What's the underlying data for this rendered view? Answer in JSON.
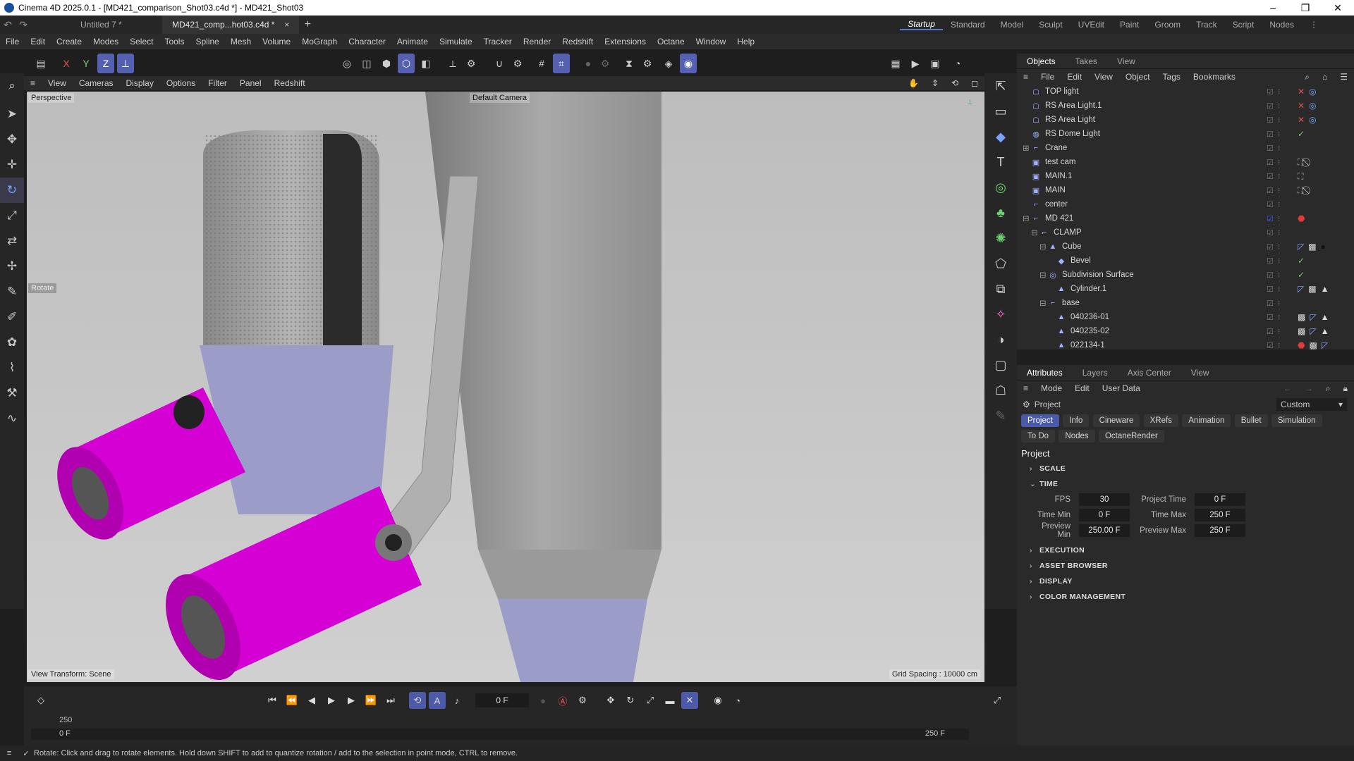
{
  "window": {
    "title": "Cinema 4D 2025.0.1 - [MD421_comparison_Shot03.c4d *] - MD421_Shot03",
    "minimize": "–",
    "maximize": "❐",
    "close": "✕"
  },
  "doc_tabs": [
    {
      "label": "Untitled 7 *"
    },
    {
      "label": "MD421_comp...hot03.c4d *",
      "close": "×"
    }
  ],
  "new_tab": "+",
  "layouts": [
    "Startup",
    "Standard",
    "Model",
    "Sculpt",
    "UVEdit",
    "Paint",
    "Groom",
    "Track",
    "Script",
    "Nodes"
  ],
  "menu": [
    "File",
    "Edit",
    "Create",
    "Modes",
    "Select",
    "Tools",
    "Spline",
    "Mesh",
    "Volume",
    "MoGraph",
    "Character",
    "Animate",
    "Simulate",
    "Tracker",
    "Render",
    "Redshift",
    "Extensions",
    "Octane",
    "Window",
    "Help"
  ],
  "axis_buttons": [
    "X",
    "Y",
    "Z"
  ],
  "viewport": {
    "menu": [
      "View",
      "Cameras",
      "Display",
      "Options",
      "Filter",
      "Panel",
      "Redshift"
    ],
    "projection": "Perspective",
    "camera": "Default Camera",
    "tool_hint": "Rotate",
    "view_transform": "View Transform: Scene",
    "grid_spacing": "Grid Spacing : 10000 cm",
    "colors": {
      "background": "#c7c7c7",
      "accent": "#d400d4",
      "lavender": "#9c9cc8"
    }
  },
  "objects_panel": {
    "tabs": [
      "Objects",
      "Takes",
      "View"
    ],
    "menu": [
      "File",
      "Edit",
      "View",
      "Object",
      "Tags",
      "Bookmarks"
    ],
    "items": [
      {
        "name": "TOP light",
        "icon": "light-icon",
        "depth": 0,
        "tags": [
          "x",
          "target"
        ]
      },
      {
        "name": "RS Area Light.1",
        "icon": "light-icon",
        "depth": 0,
        "tags": [
          "x",
          "target"
        ]
      },
      {
        "name": "RS Area Light",
        "icon": "light-icon",
        "depth": 0,
        "tags": [
          "x",
          "target"
        ]
      },
      {
        "name": "RS Dome Light",
        "icon": "dome-icon",
        "depth": 0,
        "tags": [
          "check"
        ]
      },
      {
        "name": "Crane",
        "icon": "null-icon",
        "depth": 0,
        "expander": "⊞"
      },
      {
        "name": "test cam",
        "icon": "camera-icon",
        "depth": 0,
        "tags": [
          "cam",
          "none"
        ]
      },
      {
        "name": "MAIN.1",
        "icon": "camera-icon",
        "depth": 0,
        "tags": [
          "cam"
        ]
      },
      {
        "name": "MAIN",
        "icon": "camera-icon",
        "depth": 0,
        "tags": [
          "cam",
          "none"
        ]
      },
      {
        "name": "center",
        "icon": "null-icon",
        "depth": 0
      },
      {
        "name": "MD 421",
        "icon": "null-icon",
        "depth": 0,
        "expander": "⊟",
        "tags": [
          "material-red"
        ]
      },
      {
        "name": "CLAMP",
        "icon": "null-icon",
        "depth": 1,
        "expander": "⊟"
      },
      {
        "name": "Cube",
        "icon": "polygon-icon",
        "depth": 2,
        "expander": "⊟",
        "tags": [
          "uv",
          "texture",
          "material-black"
        ]
      },
      {
        "name": "Bevel",
        "icon": "bevel-icon",
        "depth": 3,
        "tags": [
          "check"
        ]
      },
      {
        "name": "Subdivision Surface",
        "icon": "subdivision-icon",
        "depth": 2,
        "expander": "⊟",
        "tags": [
          "check"
        ]
      },
      {
        "name": "Cylinder.1",
        "icon": "polygon-icon",
        "depth": 3,
        "tags": [
          "uv",
          "texture",
          "phong"
        ]
      },
      {
        "name": "base",
        "icon": "null-icon",
        "depth": 2,
        "expander": "⊟"
      },
      {
        "name": "040236-01",
        "icon": "polygon-icon",
        "depth": 3,
        "tags": [
          "texture",
          "uv",
          "phong"
        ]
      },
      {
        "name": "040235-02",
        "icon": "polygon-icon",
        "depth": 3,
        "tags": [
          "texture",
          "uv",
          "phong"
        ]
      },
      {
        "name": "022134-1",
        "icon": "polygon-icon",
        "depth": 3,
        "tags": [
          "material-red",
          "texture",
          "uv"
        ]
      }
    ]
  },
  "attributes_panel": {
    "tabs": [
      "Attributes",
      "Layers",
      "Axis Center",
      "View"
    ],
    "menu": [
      "Mode",
      "Edit",
      "User Data"
    ],
    "context": "Project",
    "preset": "Custom",
    "buttons": [
      "Project",
      "Info",
      "Cineware",
      "XRefs",
      "Animation",
      "Bullet",
      "Simulation",
      "To Do",
      "Nodes",
      "OctaneRender"
    ],
    "heading": "Project",
    "sections": [
      {
        "label": "SCALE",
        "open": false
      },
      {
        "label": "TIME",
        "open": true
      },
      {
        "label": "EXECUTION",
        "open": false
      },
      {
        "label": "ASSET BROWSER",
        "open": false
      },
      {
        "label": "DISPLAY",
        "open": false
      },
      {
        "label": "COLOR MANAGEMENT",
        "open": false
      }
    ],
    "time_fields": {
      "fps_label": "FPS",
      "fps": "30",
      "project_time_label": "Project Time",
      "project_time": "0 F",
      "time_min_label": "Time Min",
      "time_min": "0 F",
      "time_max_label": "Time Max",
      "time_max": "250 F",
      "preview_min_label": "Preview Min",
      "preview_min": "250.00 F",
      "preview_max_label": "Preview Max",
      "preview_max": "250 F"
    }
  },
  "timeline": {
    "current_frame": "0 F",
    "ruler_value": "250",
    "start_frame": "0 F",
    "end_frame": "250 F"
  },
  "status": "Rotate: Click and drag to rotate elements. Hold down SHIFT to add to quantize rotation / add to the selection in point mode, CTRL to remove."
}
